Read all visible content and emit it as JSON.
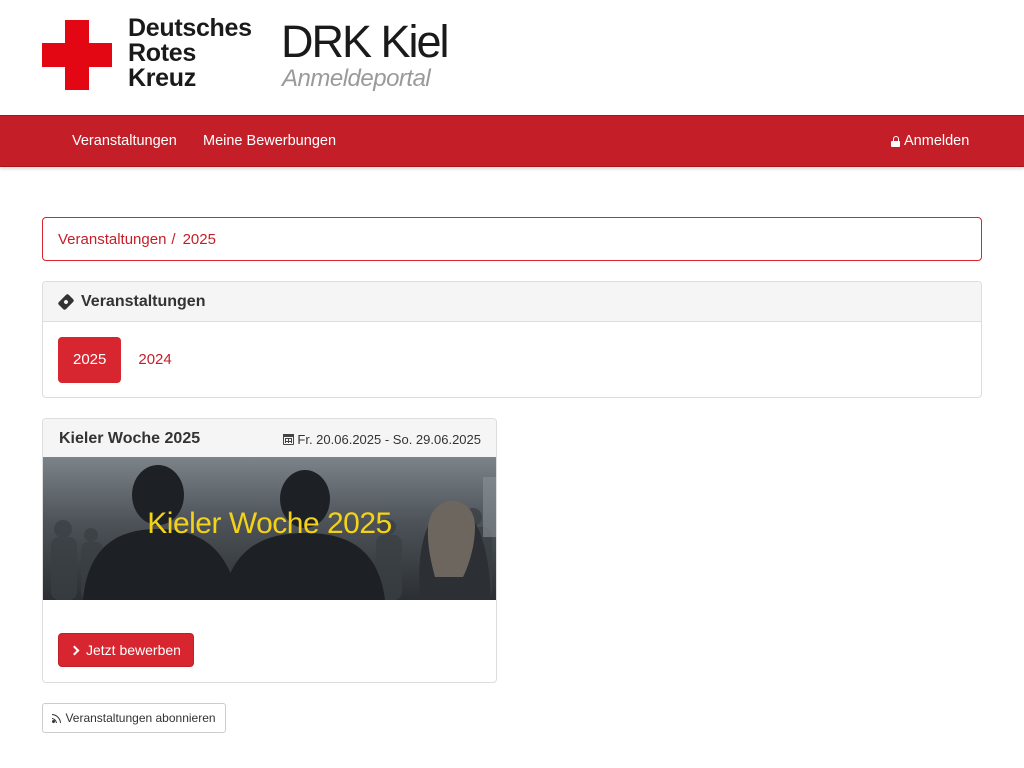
{
  "header": {
    "logo_lines": [
      "Deutsches",
      "Rotes",
      "Kreuz"
    ],
    "brand_title": "DRK Kiel",
    "brand_subtitle": "Anmeldeportal"
  },
  "navbar": {
    "items": [
      {
        "label": "Veranstaltungen"
      },
      {
        "label": "Meine Bewerbungen"
      }
    ],
    "login_label": "Anmelden",
    "login_icon": "lock-icon",
    "background_color": "#c41e28"
  },
  "breadcrumb": {
    "items": [
      "Veranstaltungen",
      "2025"
    ],
    "separator": "/"
  },
  "events_panel": {
    "title": "Veranstaltungen",
    "title_icon": "ticket-icon",
    "years": [
      {
        "label": "2025",
        "active": true
      },
      {
        "label": "2024",
        "active": false
      }
    ]
  },
  "event_card": {
    "title": "Kieler Woche 2025",
    "date_range": "Fr. 20.06.2025 - So. 29.06.2025",
    "date_icon": "calendar-icon",
    "image_caption": "Kieler Woche 2025",
    "apply_label": "Jetzt bewerben",
    "apply_icon": "chevron-right-icon"
  },
  "subscribe": {
    "label": "Veranstaltungen abonnieren",
    "icon": "rss-icon"
  },
  "colors": {
    "brand_red": "#e30613",
    "accent_red": "#d7262f",
    "caption_yellow": "#f4d215"
  }
}
